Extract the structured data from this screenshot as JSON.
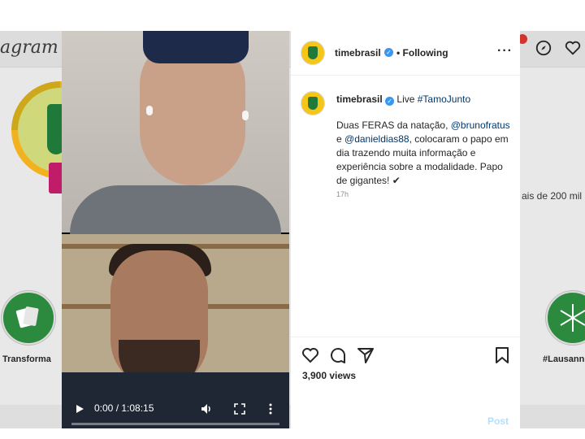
{
  "background": {
    "logo_text": "agram",
    "stat_text": "ais de 200 mil",
    "highlights": [
      {
        "label": "Transforma",
        "icon": "cards-icon"
      },
      {
        "label": "#Lausann",
        "icon": "snowflake-icon"
      }
    ]
  },
  "video": {
    "time": "0:00 / 1:08:15",
    "controls": [
      "play-icon",
      "volume-icon",
      "fullscreen-icon",
      "more-icon"
    ]
  },
  "post": {
    "username": "timebrasil",
    "follow_label": "• Following",
    "more_label": "···",
    "caption": {
      "username": "timebrasil",
      "title_plain": "Live ",
      "title_tag": "#TamoJunto",
      "text_1": "Duas FERAS da natação, ",
      "mention_1": "@brunofratus",
      "text_2": " e ",
      "mention_2": "@danieldias88",
      "text_3": ", colocaram o papo em dia trazendo muita informação e experiência sobre a modalidade. Papo de gigantes! ✔"
    },
    "time_ago": "17h",
    "views": "3,900 views",
    "post_button": "Post"
  },
  "colors": {
    "accent_link": "#00376b",
    "verified": "#3897f0",
    "post_disabled": "#b2dffc",
    "brand_yellow": "#f5c518",
    "brand_green": "#1f7a3a"
  }
}
